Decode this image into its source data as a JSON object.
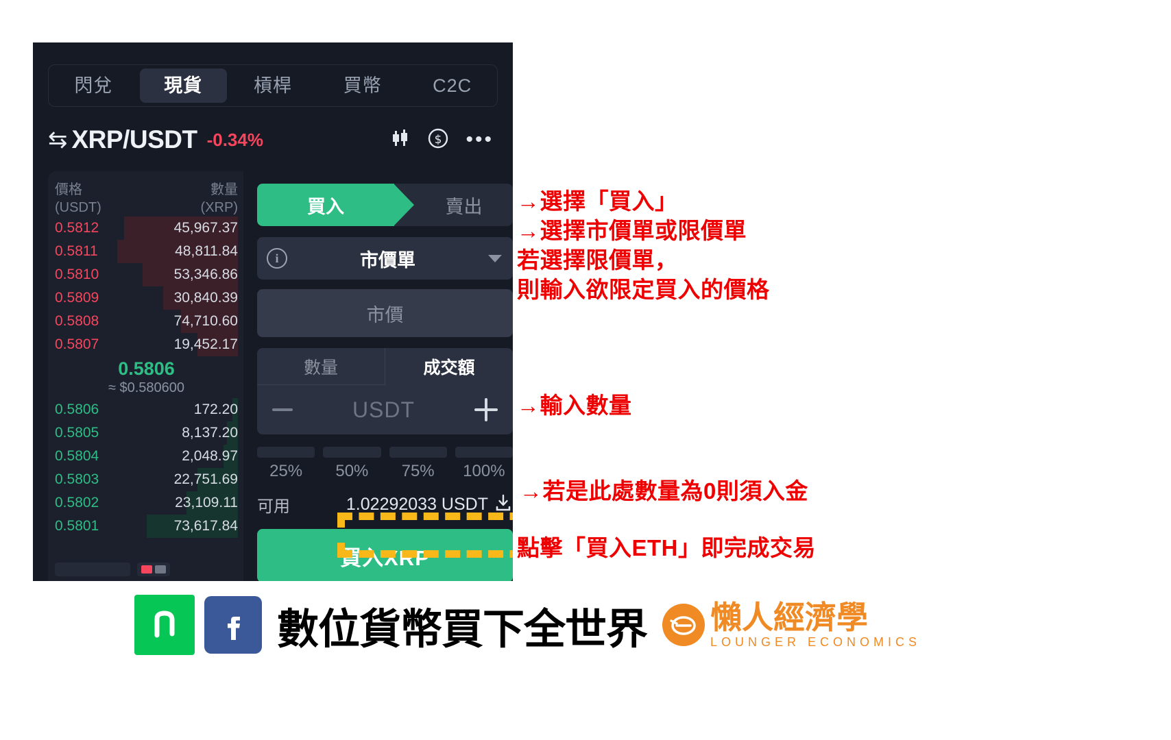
{
  "app": {
    "tabs": [
      {
        "label": "閃兌",
        "active": false
      },
      {
        "label": "現貨",
        "active": true
      },
      {
        "label": "槓桿",
        "active": false
      },
      {
        "label": "買幣",
        "active": false
      },
      {
        "label": "C2C",
        "active": false
      }
    ],
    "header": {
      "swap_icon": "⇆",
      "pair": "XRP/USDT",
      "change": "-0.34%",
      "change_color": "#f6465d",
      "icons": [
        "candlestick-icon",
        "dollar-circle-icon",
        "more-icon"
      ]
    },
    "orderbook": {
      "col_price": "價格",
      "col_price_unit": "(USDT)",
      "col_amount": "數量",
      "col_amount_unit": "(XRP)",
      "asks": [
        {
          "price": "0.5812",
          "amount": "45,967.37",
          "depth": 62
        },
        {
          "price": "0.5811",
          "amount": "48,811.84",
          "depth": 66
        },
        {
          "price": "0.5810",
          "amount": "53,346.86",
          "depth": 52
        },
        {
          "price": "0.5809",
          "amount": "30,840.39",
          "depth": 41
        },
        {
          "price": "0.5808",
          "amount": "74,710.60",
          "depth": 31
        },
        {
          "price": "0.5807",
          "amount": "19,452.17",
          "depth": 22
        }
      ],
      "mid_price": "0.5806",
      "mid_approx": "≈ $0.580600",
      "bids": [
        {
          "price": "0.5806",
          "amount": "172.20",
          "depth": 3
        },
        {
          "price": "0.5805",
          "amount": "8,137.20",
          "depth": 6
        },
        {
          "price": "0.5804",
          "amount": "2,048.97",
          "depth": 8
        },
        {
          "price": "0.5803",
          "amount": "22,751.69",
          "depth": 22
        },
        {
          "price": "0.5802",
          "amount": "23,109.11",
          "depth": 28
        },
        {
          "price": "0.5801",
          "amount": "73,617.84",
          "depth": 50
        }
      ]
    },
    "form": {
      "side_buy": "買入",
      "side_sell": "賣出",
      "order_type": "市價單",
      "price_placeholder": "市價",
      "tab_quantity": "數量",
      "tab_amount": "成交額",
      "qty_placeholder": "USDT",
      "percents": [
        "25%",
        "50%",
        "75%",
        "100%"
      ],
      "available_label": "可用",
      "available_value": "1.02292033 USDT",
      "download_icon": "download-icon",
      "submit_label": "買入XRP",
      "accent_green": "#2ebd85",
      "accent_red": "#f6465d",
      "highlight_color": "#f9b81a"
    }
  },
  "annotations": [
    {
      "id": "anno-1",
      "text": "→選擇「買入」\n→選擇市價單或限價單\n若選擇限價單，\n則輸入欲限定買入的價格"
    },
    {
      "id": "anno-2",
      "text": "→輸入數量"
    },
    {
      "id": "anno-3",
      "text": "→若是此處數量為0則須入金"
    },
    {
      "id": "anno-4",
      "text": "點擊「買入ETH」即完成交易"
    }
  ],
  "brand": {
    "line_icon": "line-icon",
    "facebook_icon": "facebook-icon",
    "slogan": "數位貨幣買下全世界",
    "lounger_mark": "lounger-logo-icon",
    "lounger_cn": "懶人經濟學",
    "lounger_en": "LOUNGER ECONOMICS",
    "brand_color": "#f08a24"
  }
}
